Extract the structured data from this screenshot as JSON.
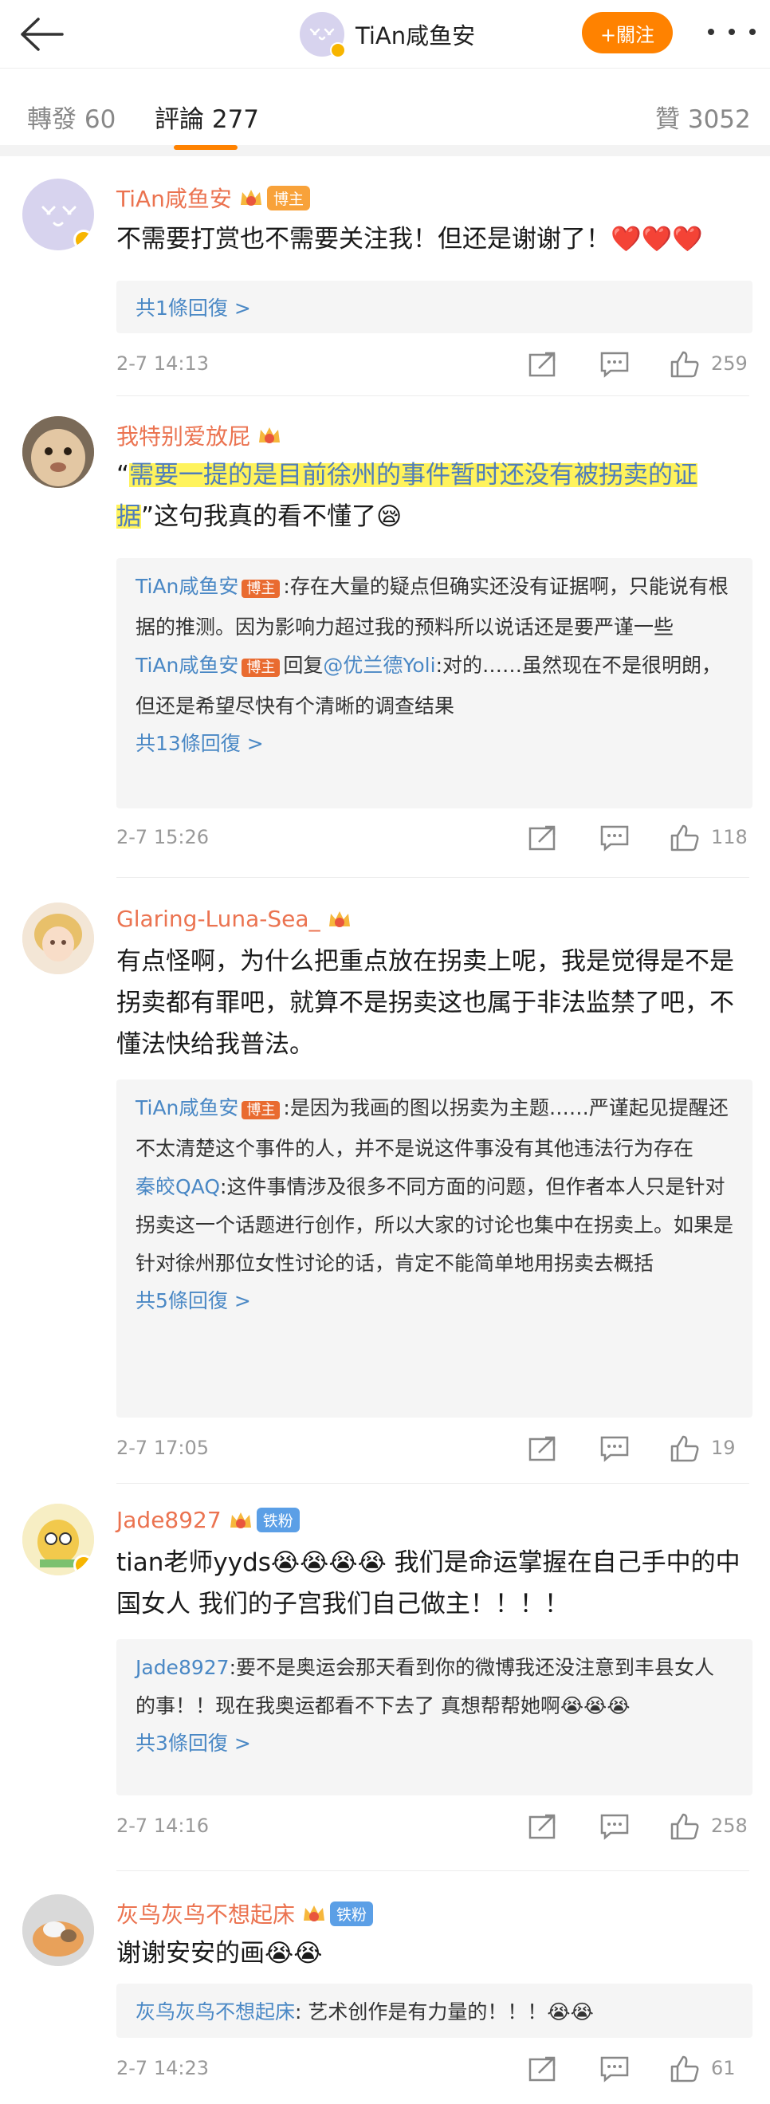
{
  "header": {
    "title": "TiAn咸鱼安",
    "follow_label": "+關注"
  },
  "tabs": {
    "repost": "轉發 60",
    "comments": "評論 277",
    "likes": "贊 3052"
  },
  "colors": {
    "accent": "#ff8200",
    "name": "#eb7350",
    "link": "#4a88c5"
  },
  "comments": [
    {
      "name": "TiAn咸鱼安",
      "level": "6",
      "tag": "博主",
      "text": "不需要打赏也不需要关注我！但还是谢谢了！❤️❤️❤️",
      "replies": [],
      "reply_more": "共1條回復 >",
      "time": "2-7 14:13",
      "likes": "259"
    },
    {
      "name": "我特别爱放屁",
      "level": "5",
      "tag": "",
      "text_quote": "需要一提的是目前徐州的事件暂时还没有被拐卖的证据",
      "text_rest": "这句我真的看不懂了😪",
      "replies": [
        {
          "name": "TiAn咸鱼安",
          "tag": "博主",
          "text": ":存在大量的疑点但确实还没有证据啊，只能说有根据的推测。因为影响力超过我的预料所以说话还是要严谨一些"
        },
        {
          "name": "TiAn咸鱼安",
          "tag": "博主",
          "pre": "回复",
          "mention": "@优兰德Yoli",
          "text": ":对的……虽然现在不是很明朗，但还是希望尽快有个清晰的调查结果"
        }
      ],
      "reply_more": "共13條回復 >",
      "time": "2-7 15:26",
      "likes": "118"
    },
    {
      "name": "Glaring-Luna-Sea_",
      "level": "",
      "tag": "",
      "text": "有点怪啊，为什么把重点放在拐卖上呢，我是觉得是不是拐卖都有罪吧，就算不是拐卖这也属于非法监禁了吧，不懂法快给我普法。",
      "replies": [
        {
          "name": "TiAn咸鱼安",
          "tag": "博主",
          "text": ":是因为我画的图以拐卖为主题……严谨起见提醒还不太清楚这个事件的人，并不是说这件事没有其他违法行为存在"
        },
        {
          "name": "秦皎QAQ",
          "tag": "",
          "text": ":这件事情涉及很多不同方面的问题，但作者本人只是针对拐卖这一个话题进行创作，所以大家的讨论也集中在拐卖上。如果是针对徐州那位女性讨论的话，肯定不能简单地用拐卖去概括"
        }
      ],
      "reply_more": "共5條回復 >",
      "time": "2-7 17:05",
      "likes": "19"
    },
    {
      "name": "Jade8927",
      "level": "5",
      "tag": "铁粉",
      "text": "tian老师yyds😭😭😭😭 我们是命运掌握在自己手中的中国女人 我们的子宫我们自己做主！！！！",
      "replies": [
        {
          "name": "Jade8927",
          "tag": "",
          "text": ":要不是奥运会那天看到你的微博我还没注意到丰县女人的事！！现在我奥运都看不下去了 真想帮帮她啊😭😭😭"
        }
      ],
      "reply_more": "共3條回復 >",
      "time": "2-7 14:16",
      "likes": "258"
    },
    {
      "name": "灰鸟灰鸟不想起床",
      "level": "4",
      "tag": "铁粉",
      "text": "谢谢安安的画😭😭",
      "replies": [
        {
          "name": "灰鸟灰鸟不想起床",
          "tag": "",
          "text": ": 艺术创作是有力量的！！！😭😭"
        }
      ],
      "reply_more": "",
      "time": "2-7 14:23",
      "likes": "61"
    }
  ]
}
